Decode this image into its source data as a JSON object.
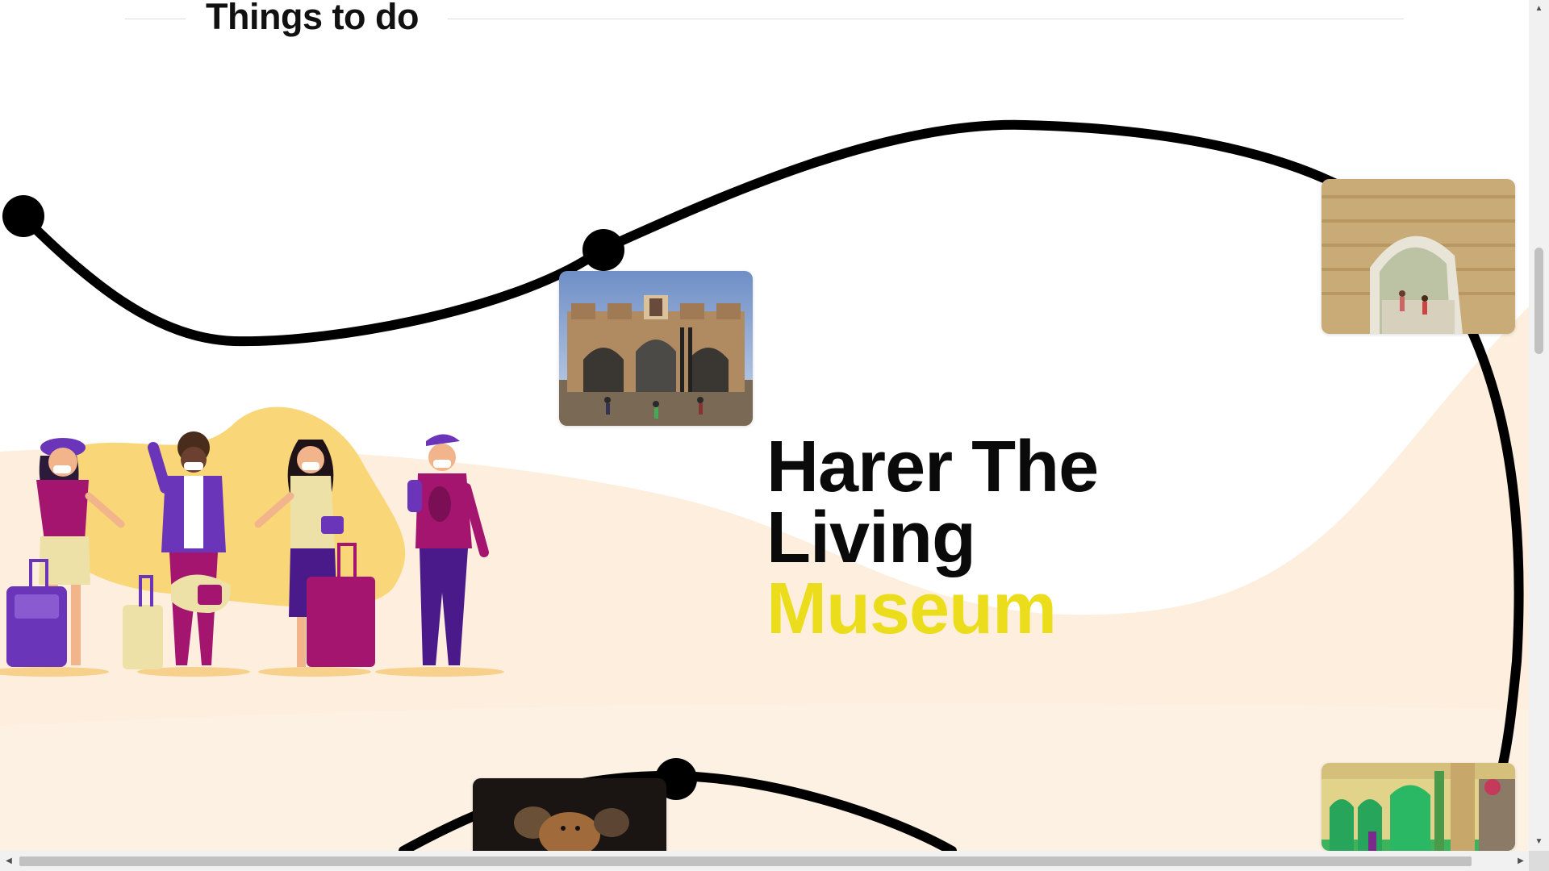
{
  "section": {
    "title": "Things to do"
  },
  "hero": {
    "line1": "Harer The",
    "line2": "Living",
    "line3": "Museum"
  },
  "images": {
    "gate": "harar-gate-photo",
    "arch": "stone-arch-photo",
    "hyenas": "hyenas-photo",
    "street": "green-doors-street-photo",
    "travelers": "travelers-illustration"
  },
  "colors": {
    "accent": "#ecdd1c",
    "text": "#0a0a0a",
    "peach": "#fdeedd",
    "road": "#000000",
    "purple": "#6a35b8",
    "magenta": "#a3156f",
    "yellow": "#f9d779"
  },
  "scrollbars": {
    "up": "▲",
    "down": "▼",
    "left": "◀",
    "right": "▶"
  }
}
